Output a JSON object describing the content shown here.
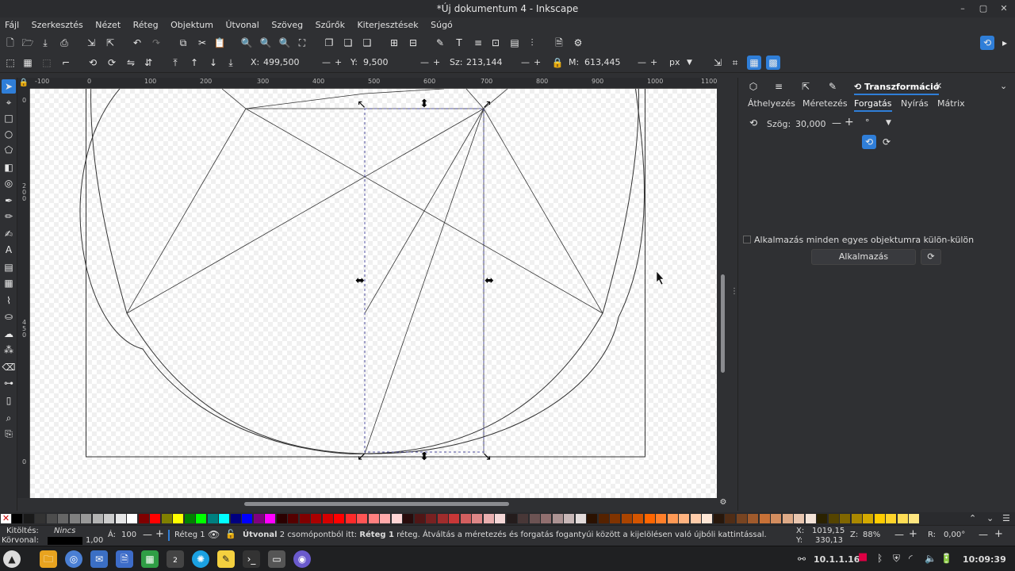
{
  "window": {
    "title": "*Új dokumentum 4 - Inkscape",
    "min": "–",
    "max": "▢",
    "close": "✕"
  },
  "menu": [
    "Fájl",
    "Szerkesztés",
    "Nézet",
    "Réteg",
    "Objektum",
    "Útvonal",
    "Szöveg",
    "Szűrők",
    "Kiterjesztések",
    "Súgó"
  ],
  "tool_controls": {
    "x_label": "X:",
    "x_value": "499,500",
    "y_label": "Y:",
    "y_value": "9,500",
    "w_label": "Sz:",
    "w_value": "213,144",
    "h_label": "M:",
    "h_value": "613,445",
    "unit": "px"
  },
  "ruler_top_labels": [
    "-100",
    "0",
    "100",
    "200",
    "300",
    "400",
    "500",
    "600",
    "700",
    "800",
    "900",
    "1000",
    "1100"
  ],
  "ruler_left_labels": [
    "0",
    "2",
    "0",
    "0",
    "4",
    "5",
    "0",
    "0"
  ],
  "dock": {
    "active_tab": "Transzformáció",
    "subtabs": [
      "Áthelyezés",
      "Méretezés",
      "Forgatás",
      "Nyírás",
      "Mátrix"
    ],
    "active_subtab": "Forgatás",
    "angle_label": "Szög:",
    "angle_value": "30,000",
    "angle_unit": "°",
    "apply_each_label": "Alkalmazás minden egyes objektumra külön-külön",
    "apply_button": "Alkalmazás"
  },
  "status": {
    "fill_label": "Kitöltés:",
    "fill_value": "Nincs",
    "stroke_label": "Körvonal:",
    "stroke_width": "1,00",
    "opacity_label": "Á:",
    "opacity_value": "100",
    "layer": "Réteg 1",
    "message_bold": "Útvonal",
    "message": " 2 csomópontból itt: ",
    "message_layer": "Réteg 1",
    "message_tail": " réteg. Átváltás a méretezés és forgatás fogantyúi között a kijelölésen való újbóli kattintással.",
    "x_label": "X:",
    "x_coord": "1019,15",
    "y_label": "Y:",
    "y_coord": "330,13",
    "zoom_label": "Z:",
    "zoom": "88%",
    "rotate_label": "R:",
    "rotate": "0,00°"
  },
  "taskbar": {
    "ip": "10.1.1.16",
    "clock": "10:09:39",
    "workspace": "2"
  },
  "colors": {
    "accent": "#2f7ed8",
    "canvas_line": "#333333",
    "selection": "#5050a0"
  },
  "palette": [
    "#000000",
    "#1a1a1a",
    "#333333",
    "#4d4d4d",
    "#666666",
    "#808080",
    "#999999",
    "#b3b3b3",
    "#cccccc",
    "#e6e6e6",
    "#ffffff",
    "#800000",
    "#ff0000",
    "#808000",
    "#ffff00",
    "#008000",
    "#00ff00",
    "#008080",
    "#00ffff",
    "#000080",
    "#0000ff",
    "#800080",
    "#ff00ff",
    "#2b0000",
    "#550000",
    "#800000",
    "#aa0000",
    "#d40000",
    "#ff0000",
    "#ff2a2a",
    "#ff5555",
    "#ff8080",
    "#ffaaaa",
    "#ffd5d5",
    "#280b0b",
    "#501616",
    "#782121",
    "#a02c2c",
    "#c83737",
    "#d35f5f",
    "#de8787",
    "#e9afaf",
    "#f4d7d7",
    "#241c1c",
    "#483737",
    "#6c5353",
    "#916f6f",
    "#ac9393",
    "#c8b7b7",
    "#e3dbdb",
    "#2b1100",
    "#552200",
    "#803300",
    "#aa4400",
    "#d45500",
    "#ff6600",
    "#ff7f2a",
    "#ff9955",
    "#ffb380",
    "#ffccaa",
    "#ffe6d5",
    "#28170b",
    "#502d16",
    "#784421",
    "#a05a2c",
    "#c87137",
    "#d38d5f",
    "#deaa87",
    "#e9c6af",
    "#f4e3d7",
    "#2b2200",
    "#554400",
    "#806600",
    "#aa8800",
    "#d4aa00",
    "#ffcc00",
    "#ffd42a",
    "#ffdd55",
    "#ffe680"
  ]
}
